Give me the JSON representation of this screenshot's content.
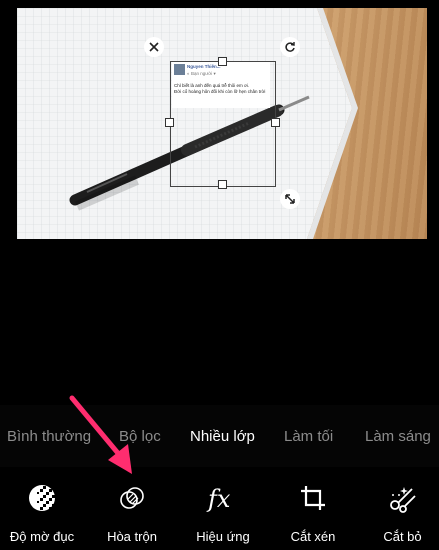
{
  "overlay": {
    "post_name": "Nguyen Thiên...",
    "post_sub": "◐ Bạn người ▾",
    "post_line1": "Chỉ biết là anh đến quá trễ thôi em ơi.",
    "post_line2": "Đời cổ hoàng hôn đối khi còn lỡ hẹn chân trời"
  },
  "blend_modes": [
    "Bình thường",
    "Bộ lọc",
    "Nhiều lớp",
    "Làm tối",
    "Làm sáng"
  ],
  "blend_active": "Nhiều lớp",
  "tools": [
    {
      "label": "Độ mờ đục",
      "icon": "opacity-icon"
    },
    {
      "label": "Hòa trộn",
      "icon": "blend-icon"
    },
    {
      "label": "Hiệu ứng",
      "icon": "fx-icon"
    },
    {
      "label": "Cắt xén",
      "icon": "crop-icon"
    },
    {
      "label": "Cắt bỏ",
      "icon": "cutout-icon"
    }
  ],
  "selected_tool": "Hòa trộn",
  "colors": {
    "accent": "#3aa0d8",
    "arrow": "#ff2d6f",
    "background": "#000000"
  }
}
